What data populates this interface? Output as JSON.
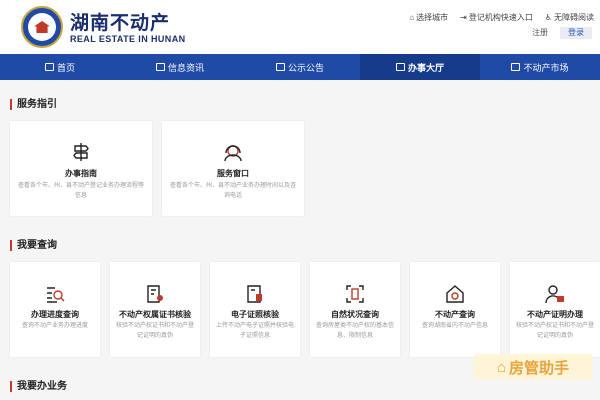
{
  "header": {
    "brand_cn": "湖南不动产",
    "brand_en": "REAL ESTATE IN HUNAN",
    "top_links": [
      "选择城市",
      "登记机构快速入口",
      "无障碍阅读"
    ],
    "register": "注册",
    "login": "登录"
  },
  "nav": {
    "items": [
      "首页",
      "信息资讯",
      "公示公告",
      "办事大厅",
      "不动产市场"
    ],
    "active_index": 3
  },
  "sections": {
    "guide_title": "服务指引",
    "query_title": "我要查询",
    "business_title": "我要办业务"
  },
  "guide_cards": [
    {
      "title": "办事指南",
      "desc": "查看各个市、州、县不动产登记业务办理流程等信息"
    },
    {
      "title": "服务窗口",
      "desc": "查看各个市、州、县不动产业务办理时间以及咨询电话"
    }
  ],
  "query_cards": [
    {
      "title": "办理进度查询",
      "desc": "查询不动产业务办理进度"
    },
    {
      "title": "不动产权属证书核验",
      "desc": "核验不动产权证书和不动产登记证明的真伪"
    },
    {
      "title": "电子证照核验",
      "desc": "上传不动产电子证照并核验电子证照信息"
    },
    {
      "title": "自然状况查询",
      "desc": "查询房屋类不动产权的基本信息、限制信息"
    },
    {
      "title": "不动产查询",
      "desc": "查询湖南省内不动产信息"
    },
    {
      "title": "不动产证明办理",
      "desc": "核验不动产权证书和不动产登记证明的真伪"
    }
  ],
  "watermark": "房管助手",
  "colors": {
    "nav": "#1f4aa5",
    "accent": "#c0392b"
  }
}
